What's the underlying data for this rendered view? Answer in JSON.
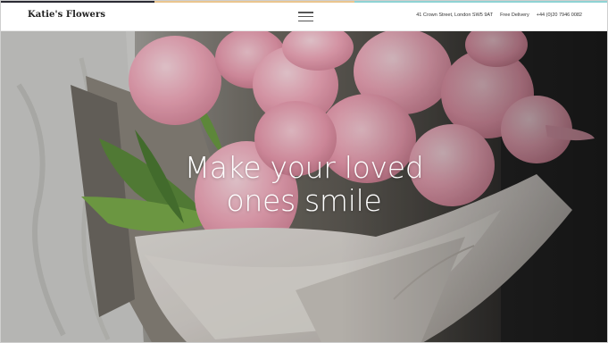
{
  "header": {
    "brand": "Katie's Flowers",
    "menu_icon": "hamburger-menu-icon",
    "address": "41 Crown Street, London SW5 9AT",
    "delivery": "Free Delivery",
    "phone": "+44 (0)20 7946 0082"
  },
  "hero": {
    "headline_line1": "Make your loved",
    "headline_line2": "ones smile",
    "image": "pink-tulip-bouquet-photo"
  },
  "colors": {
    "strip_dark": "#2b2b33",
    "strip_gold": "#eac58f",
    "strip_teal": "#8fd3d4",
    "tulip_pink": "#f1a9bb",
    "text_dark": "#1e1e1e"
  }
}
